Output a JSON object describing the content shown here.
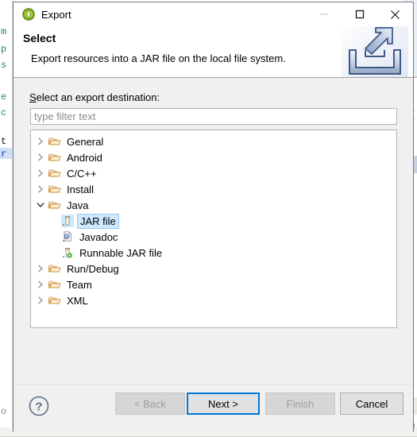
{
  "window": {
    "title": "Export",
    "title_icon": "eclipse-export-icon",
    "controls": [
      {
        "name": "minimize-button",
        "glyph": "minimize-icon",
        "enabled": false
      },
      {
        "name": "maximize-button",
        "glyph": "maximize-icon",
        "enabled": true
      },
      {
        "name": "close-button",
        "glyph": "close-icon",
        "enabled": true
      }
    ]
  },
  "header": {
    "title": "Select",
    "description": "Export resources into a JAR file on the local file system.",
    "banner_icon": "export-tray-arrow-icon"
  },
  "form": {
    "label_mnemonic": "S",
    "label_rest": "elect an export destination:",
    "filter": {
      "value": "",
      "placeholder": "type filter text"
    }
  },
  "tree": {
    "items": [
      {
        "label": "General",
        "icon": "folder-icon",
        "expanded": false,
        "level": 0,
        "selected": false
      },
      {
        "label": "Android",
        "icon": "folder-icon",
        "expanded": false,
        "level": 0,
        "selected": false
      },
      {
        "label": "C/C++",
        "icon": "folder-icon",
        "expanded": false,
        "level": 0,
        "selected": false
      },
      {
        "label": "Install",
        "icon": "folder-icon",
        "expanded": false,
        "level": 0,
        "selected": false
      },
      {
        "label": "Java",
        "icon": "folder-icon",
        "expanded": true,
        "level": 0,
        "selected": false
      },
      {
        "label": "JAR file",
        "icon": "jar-file-icon",
        "expanded": null,
        "level": 1,
        "selected": true
      },
      {
        "label": "Javadoc",
        "icon": "javadoc-icon",
        "expanded": null,
        "level": 1,
        "selected": false
      },
      {
        "label": "Runnable JAR file",
        "icon": "runnable-jar-icon",
        "expanded": null,
        "level": 1,
        "selected": false
      },
      {
        "label": "Run/Debug",
        "icon": "folder-icon",
        "expanded": false,
        "level": 0,
        "selected": false
      },
      {
        "label": "Team",
        "icon": "folder-icon",
        "expanded": false,
        "level": 0,
        "selected": false
      },
      {
        "label": "XML",
        "icon": "folder-icon",
        "expanded": false,
        "level": 0,
        "selected": false
      }
    ]
  },
  "buttons": {
    "help": {
      "label": "?",
      "icon": "help-circle-icon"
    },
    "back": {
      "label": "< Back",
      "mnemonic": "B",
      "enabled": false,
      "default": false
    },
    "next": {
      "label": "Next >",
      "mnemonic": "N",
      "enabled": true,
      "default": true
    },
    "finish": {
      "label": "Finish",
      "mnemonic": "F",
      "enabled": false,
      "default": false
    },
    "cancel": {
      "label": "Cancel",
      "mnemonic": "",
      "enabled": true,
      "default": false
    }
  },
  "background": {
    "left_column_chars": [
      "m",
      "p",
      "s",
      "e",
      "c",
      "t",
      "r"
    ],
    "left_column_colors": [
      "#2a7f7f",
      "#2a7f7f",
      "#2a7f7f",
      "#2a7f7f",
      "#2a7f7f",
      "#000000",
      "#0000c0"
    ]
  },
  "colors": {
    "accent": "#0078d7",
    "selection": "#cde8ff",
    "selection_border": "#99c9ef",
    "dialog_bg": "#f0f0f0",
    "folder_icon": "#e8a33d",
    "title_icon_green": "#8ec31f"
  }
}
